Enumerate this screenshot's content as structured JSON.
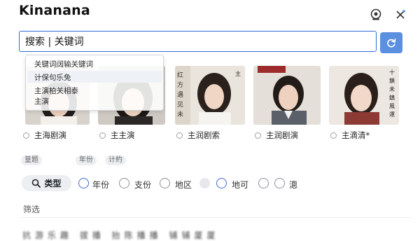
{
  "app": {
    "title": "Kinanana"
  },
  "header": {
    "icons": [
      "webcam-icon",
      "close-icon"
    ]
  },
  "search": {
    "value": "搜索 | 关键词",
    "refresh_icon": "refresh-icon"
  },
  "dropdown": {
    "items": [
      "关键词阔输关键词",
      "计保句乐免",
      "主演柏关相泰",
      "主演"
    ]
  },
  "results": [
    {
      "caption": "主海剧演",
      "thumb_label": ""
    },
    {
      "caption": "主主演",
      "thumb_label": ""
    },
    {
      "caption": "主润剧索",
      "thumb_label": "红方遇见未来"
    },
    {
      "caption": "主润剧演",
      "thumb_label": ""
    },
    {
      "caption": "主滴清*",
      "thumb_label": "十鎖未鎮風十運"
    }
  ],
  "tags": [
    "篁题",
    "年份",
    "计約"
  ],
  "filters": {
    "type_button": "类型",
    "options": [
      "年份",
      "支份",
      "地区",
      "地可",
      "漗"
    ]
  },
  "section": {
    "label": "筛选"
  },
  "blurred_row": "抗游乐趣 拔播    抬陈播播    铺铺厦厦",
  "colors": {
    "accent": "#2f6fd6",
    "button": "#5b8fe0"
  }
}
